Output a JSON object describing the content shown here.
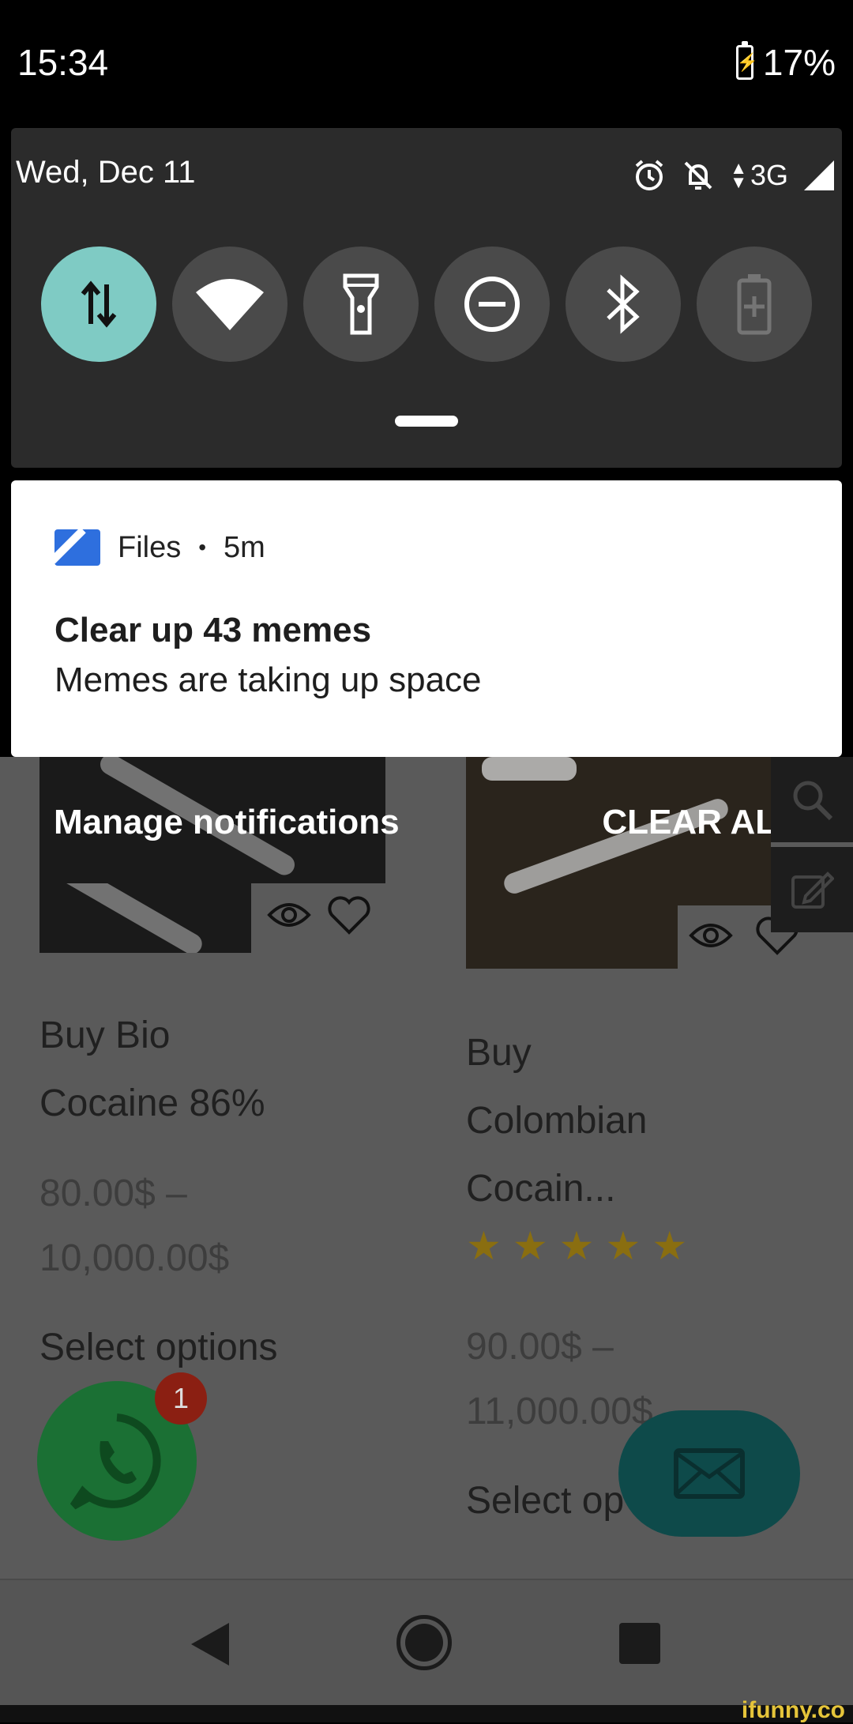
{
  "status_bar": {
    "time": "15:34",
    "battery": "17%"
  },
  "shade": {
    "date": "Wed, Dec 11",
    "network": "3G",
    "tiles": [
      {
        "name": "mobile-data",
        "icon": "data-arrows-icon",
        "active": true
      },
      {
        "name": "wifi",
        "icon": "wifi-icon",
        "active": false
      },
      {
        "name": "flashlight",
        "icon": "flashlight-icon",
        "active": false
      },
      {
        "name": "do-not-disturb",
        "icon": "do-not-disturb-icon",
        "active": false
      },
      {
        "name": "bluetooth",
        "icon": "bluetooth-icon",
        "active": false
      },
      {
        "name": "battery-saver",
        "icon": "battery-saver-icon",
        "active": false
      }
    ]
  },
  "notification": {
    "app": "Files",
    "time": "5m",
    "title": "Clear up 43 memes",
    "text": "Memes are taking up space"
  },
  "actions": {
    "manage": "Manage notifications",
    "clear_all": "CLEAR ALL"
  },
  "products": [
    {
      "line1": "Buy Bio",
      "line2": "Cocaine 86%",
      "price1": "80.00$ –",
      "price2": "10,000.00$",
      "button": "Select options"
    },
    {
      "line1": "Buy",
      "line2": "Colombian",
      "line3": "Cocain...",
      "rating": 5,
      "price1": "90.00$ –",
      "price2": "11,000.00$",
      "button": "Select op"
    }
  ],
  "whatsapp": {
    "badge": "1"
  },
  "watermark": "ifunny.co",
  "colors": {
    "accent_tile": "#7fcbc4",
    "files_blue": "#2e6fde",
    "whatsapp_green": "#1b7034",
    "star": "#8a6e10"
  }
}
